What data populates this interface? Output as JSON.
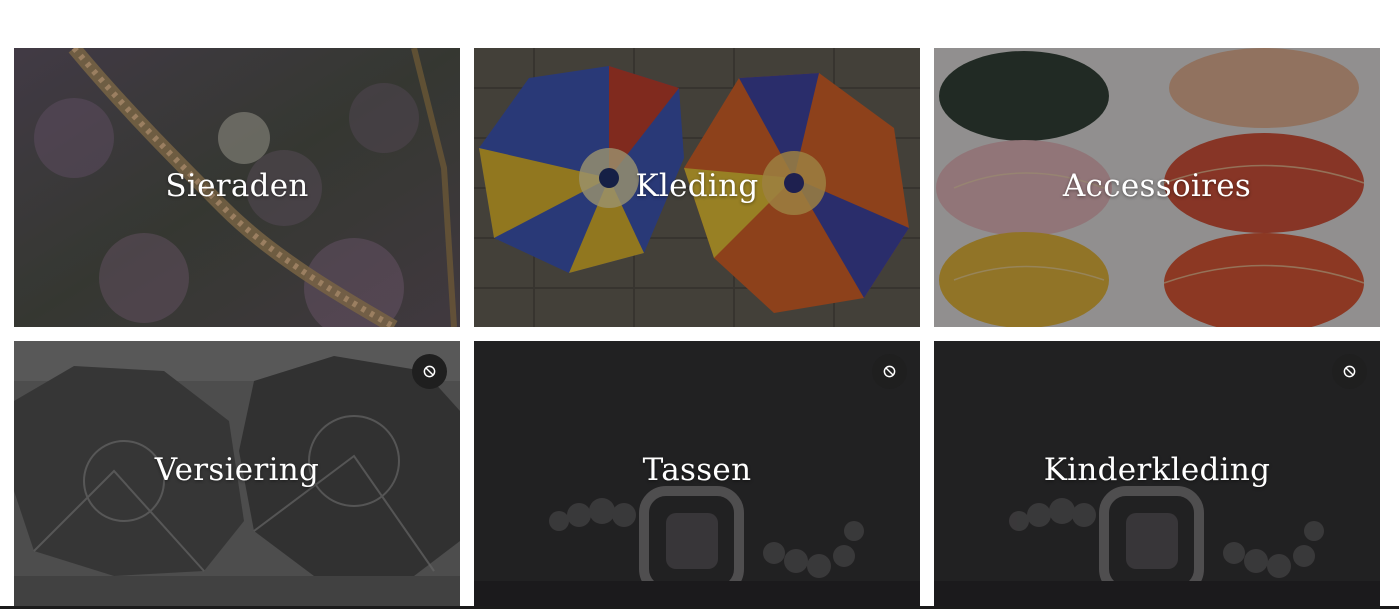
{
  "categories": [
    {
      "label": "Sieraden",
      "image": "jewelry-photo"
    },
    {
      "label": "Kleding",
      "image": "embroidered-umbrellas-photo"
    },
    {
      "label": "Accessoires",
      "image": "embroidered-pouches-photo"
    },
    {
      "label": "Versiering",
      "image": "umbrellas-grayscale-photo",
      "badge_icon": "no-entry-icon"
    },
    {
      "label": "Tassen",
      "image": "ring-placeholder-photo",
      "badge_icon": "no-entry-icon"
    },
    {
      "label": "Kinderkleding",
      "image": "ring-placeholder-photo",
      "badge_icon": "no-entry-icon"
    }
  ]
}
